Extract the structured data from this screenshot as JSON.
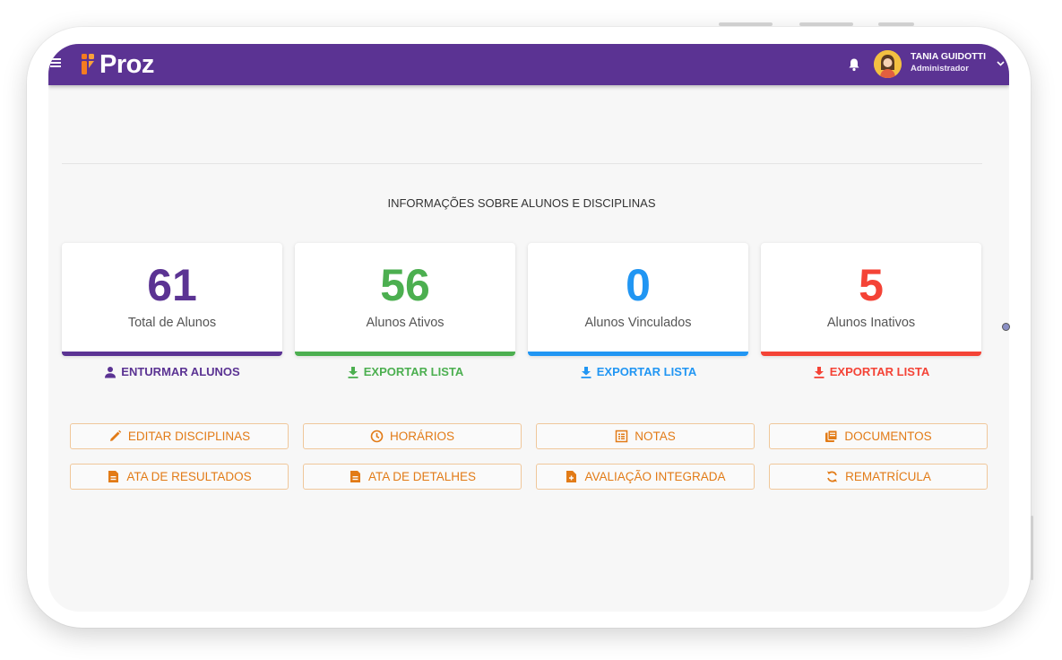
{
  "header": {
    "brand": "Proz",
    "user_name": "TANIA GUIDOTTI",
    "user_role": "Administrador",
    "bar_color": "#5b3393"
  },
  "main": {
    "section_title": "INFORMAÇÕES SOBRE ALUNOS E DISCIPLINAS",
    "cards": [
      {
        "value": "61",
        "label": "Total de Alunos",
        "color": "#5b3393",
        "link": "ENTURMAR ALUNOS",
        "link_icon": "user-icon"
      },
      {
        "value": "56",
        "label": "Alunos Ativos",
        "color": "#4caf50",
        "link": "EXPORTAR LISTA",
        "link_icon": "download-icon"
      },
      {
        "value": "0",
        "label": "Alunos Vinculados",
        "color": "#2196f3",
        "link": "EXPORTAR LISTA",
        "link_icon": "download-icon"
      },
      {
        "value": "5",
        "label": "Alunos Inativos",
        "color": "#f44336",
        "link": "EXPORTAR LISTA",
        "link_icon": "download-icon"
      }
    ],
    "actions": [
      {
        "label": "EDITAR DISCIPLINAS",
        "icon": "pencil-icon"
      },
      {
        "label": "HORÁRIOS",
        "icon": "clock-icon"
      },
      {
        "label": "NOTAS",
        "icon": "list-icon"
      },
      {
        "label": "DOCUMENTOS",
        "icon": "documents-icon"
      },
      {
        "label": "ATA DE RESULTADOS",
        "icon": "document-icon"
      },
      {
        "label": "ATA DE DETALHES",
        "icon": "document-icon"
      },
      {
        "label": "AVALIAÇÃO INTEGRADA",
        "icon": "file-plus-icon"
      },
      {
        "label": "REMATRÍCULA",
        "icon": "refresh-icon"
      }
    ],
    "action_color": "#e27b17"
  }
}
